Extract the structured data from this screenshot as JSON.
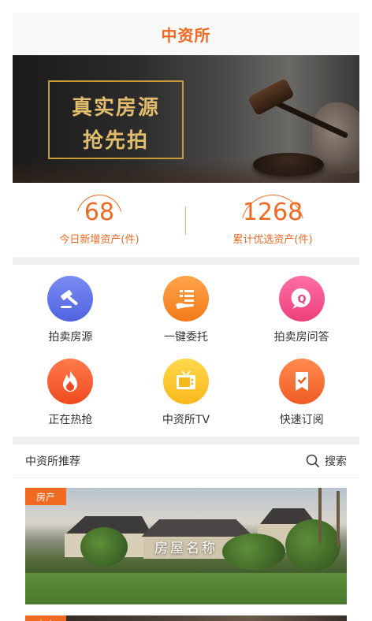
{
  "header": {
    "title": "中资所"
  },
  "banner": {
    "line1": "真实房源",
    "line2": "抢先拍"
  },
  "stats": [
    {
      "value": "68",
      "label": "今日新增资产(件)"
    },
    {
      "value": "1268",
      "label": "累计优选资产(件)"
    }
  ],
  "menu": [
    {
      "label": "拍卖房源",
      "icon": "gavel-icon"
    },
    {
      "label": "一键委托",
      "icon": "hand-list-icon"
    },
    {
      "label": "拍卖房问答",
      "icon": "question-bubble-icon"
    },
    {
      "label": "正在热抢",
      "icon": "flame-icon"
    },
    {
      "label": "中资所TV",
      "icon": "tv-icon"
    },
    {
      "label": "快速订阅",
      "icon": "bookmark-check-icon"
    }
  ],
  "recommend": {
    "title": "中资所推荐",
    "search_label": "搜索",
    "cards": [
      {
        "tag": "房产",
        "name": "房屋名称"
      },
      {
        "tag": "房产"
      }
    ]
  },
  "colors": {
    "accent": "#f06a22",
    "gold": "#e1bd6d"
  }
}
